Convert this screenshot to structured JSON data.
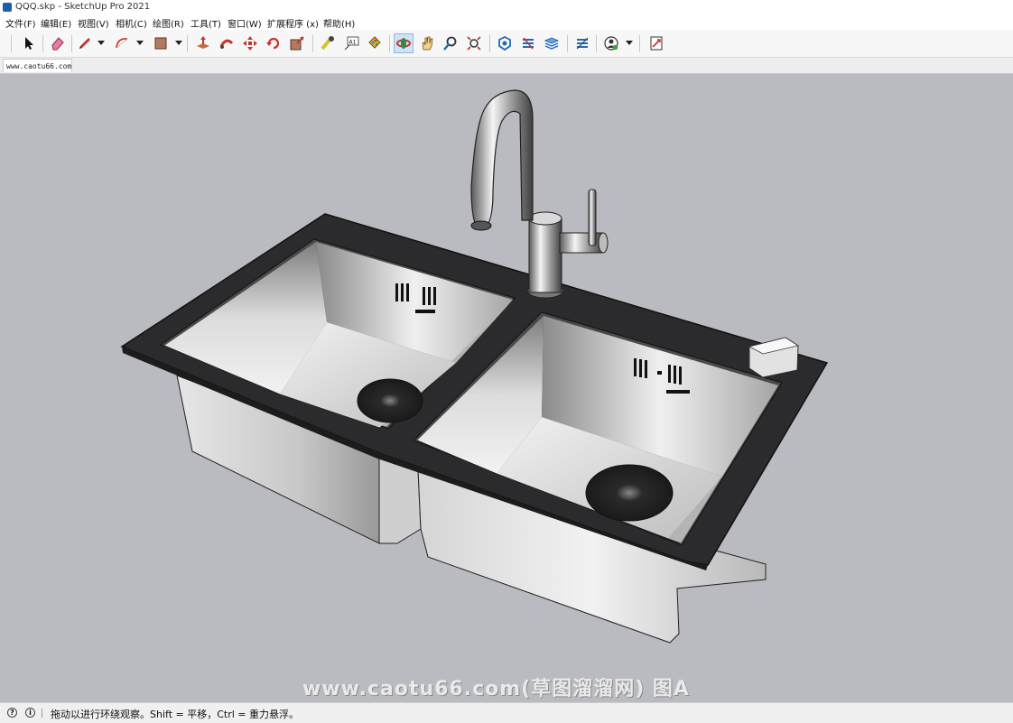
{
  "window": {
    "title": "QQQ.skp - SketchUp Pro 2021"
  },
  "menu": [
    "文件(F)",
    "编辑(E)",
    "视图(V)",
    "相机(C)",
    "绘图(R)",
    "工具(T)",
    "窗口(W)",
    "扩展程序 (x)",
    "帮助(H)"
  ],
  "toolbar": {
    "tools": [
      "select-tool",
      "eraser-tool",
      "pencil-line-tool",
      "arc-tool",
      "shape-tool",
      "push-pull-tool",
      "follow-me-tool",
      "move-tool",
      "rotate-tool",
      "scale-tool",
      "tape-measure-tool",
      "text-tool",
      "paint-bucket-tool",
      "orbit-tool",
      "pan-tool",
      "zoom-tool",
      "zoom-extents-tool",
      "warehouse-tool",
      "extension-warehouse-tool",
      "layout-tool",
      "extension-manager-tool",
      "profile-tool",
      "send-to-layout-tool"
    ],
    "text_tool_label": "A1",
    "active_tool": "orbit-tool"
  },
  "tabs": [
    {
      "label": "www.caotu66.com"
    }
  ],
  "status": {
    "message": "拖动以进行环绕观察。Shift = 平移，Ctrl = 重力悬浮。"
  },
  "watermark": "www.caotu66.com(草图溜溜网) 图A",
  "colors": {
    "viewport_bg": "#b9bbc0",
    "countertop": "#2b2b2d",
    "steel_light": "#e8e8e8",
    "steel_dark": "#8e8e8e",
    "active_tool_bg": "#cfe3f7"
  }
}
